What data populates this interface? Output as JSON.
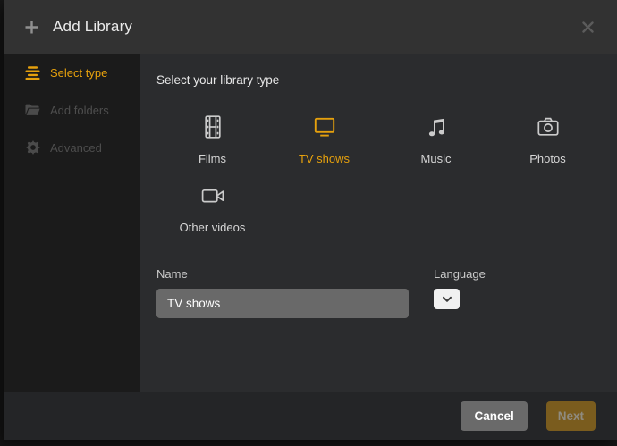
{
  "header": {
    "title": "Add Library"
  },
  "sidebar": {
    "items": [
      {
        "label": "Select type",
        "icon": "list-icon",
        "active": true
      },
      {
        "label": "Add folders",
        "icon": "folder-icon",
        "active": false
      },
      {
        "label": "Advanced",
        "icon": "gear-icon",
        "active": false
      }
    ]
  },
  "main": {
    "heading": "Select your library type",
    "types": [
      {
        "label": "Films",
        "icon": "film-strip-icon",
        "selected": false
      },
      {
        "label": "TV shows",
        "icon": "tv-icon",
        "selected": true
      },
      {
        "label": "Music",
        "icon": "music-note-icon",
        "selected": false
      },
      {
        "label": "Photos",
        "icon": "camera-icon",
        "selected": false
      },
      {
        "label": "Other videos",
        "icon": "video-camera-icon",
        "selected": false
      }
    ],
    "name_field": {
      "label": "Name",
      "value": "TV shows"
    },
    "language_field": {
      "label": "Language"
    }
  },
  "footer": {
    "cancel_label": "Cancel",
    "next_label": "Next",
    "next_enabled": false
  },
  "colors": {
    "accent": "#e5a00d",
    "header_bg": "#323232",
    "sidebar_bg": "#1b1b1b",
    "body_bg": "#2b2c2e",
    "footer_bg": "#242527",
    "input_bg": "#696969",
    "cancel_bg": "#6a6a6a",
    "next_disabled_bg": "#7a5c1e"
  }
}
